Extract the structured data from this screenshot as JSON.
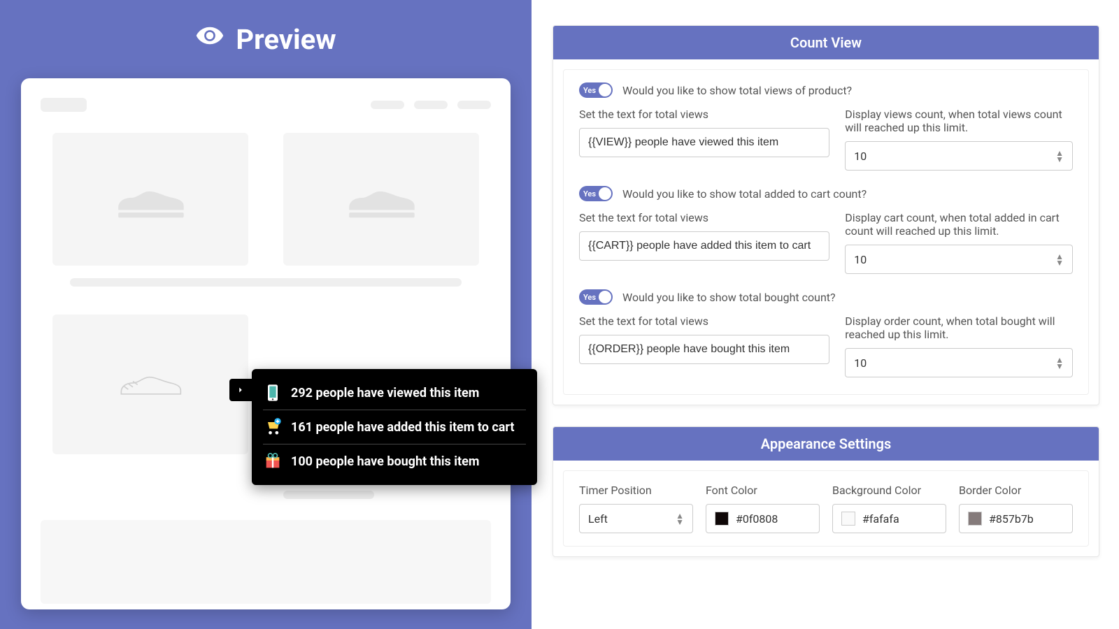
{
  "preview": {
    "title": "Preview",
    "popup": {
      "views_text": "292 people have viewed this item",
      "cart_text": "161 people have added this item to cart",
      "bought_text": "100 people have bought this item"
    }
  },
  "countView": {
    "header": "Count View",
    "views": {
      "toggle_text": "Yes",
      "question": "Would you like to show total views of product?",
      "text_label": "Set the text for total views",
      "text_value": "{{VIEW}} people have viewed this item",
      "limit_label": "Display views count, when total views count will reached up this limit.",
      "limit_value": "10"
    },
    "cart": {
      "toggle_text": "Yes",
      "question": "Would you like to show total added to cart count?",
      "text_label": "Set the text for total views",
      "text_value": "{{CART}} people have added this item to cart",
      "limit_label": "Display cart count, when total added in cart count will reached up this limit.",
      "limit_value": "10"
    },
    "bought": {
      "toggle_text": "Yes",
      "question": "Would you like to show total bought count?",
      "text_label": "Set the text for total views",
      "text_value": "{{ORDER}} people have bought this item",
      "limit_label": "Display order count, when total bought will reached up this limit.",
      "limit_value": "10"
    }
  },
  "appearance": {
    "header": "Appearance Settings",
    "timer_position_label": "Timer Position",
    "timer_position_value": "Left",
    "font_color_label": "Font Color",
    "font_color_value": "#0f0808",
    "bg_color_label": "Background Color",
    "bg_color_value": "#fafafa",
    "border_color_label": "Border Color",
    "border_color_value": "#857b7b"
  }
}
